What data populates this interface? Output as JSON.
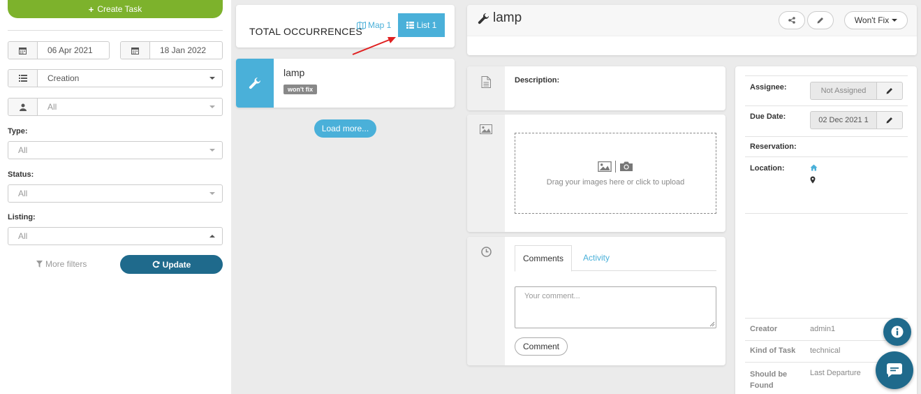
{
  "left_panel": {
    "create_task_label": "Create Task",
    "date_from": "06 Apr 2021",
    "date_to": "18 Jan 2022",
    "sort_value": "Creation",
    "user_placeholder": "All",
    "type_label": "Type:",
    "type_value": "All",
    "status_label": "Status:",
    "status_value": "All",
    "listing_label": "Listing:",
    "listing_value": "All",
    "more_filters_label": "More filters",
    "update_label": "Update"
  },
  "middle_panel": {
    "total_label": "TOTAL OCCURRENCES",
    "map_label": "Map 1",
    "list_label": "List 1",
    "task": {
      "title": "lamp",
      "badge": "won't fix"
    },
    "load_more_label": "Load more..."
  },
  "detail": {
    "title": "lamp",
    "status_dropdown": "Won't Fix",
    "description_label": "Description:",
    "upload_text": "Drag your images here or click to upload",
    "tabs": {
      "comments": "Comments",
      "activity": "Activity"
    },
    "comment_placeholder": "Your comment...",
    "comment_button": "Comment"
  },
  "info_panel": {
    "assignee_label": "Assignee:",
    "assignee_value": "Not Assigned",
    "due_date_label": "Due Date:",
    "due_date_value": "02 Dec 2021 1",
    "reservation_label": "Reservation:",
    "location_label": "Location:",
    "creator_label": "Creator",
    "creator_value": "admin1",
    "kind_label": "Kind of Task",
    "kind_value": "technical",
    "should_be_found_label_1": "Should be",
    "should_be_found_label_2": "Found",
    "should_be_found_value": "Last Departure"
  },
  "colors": {
    "green": "#7db22c",
    "blue_accent": "#4ab0d9",
    "dark_blue": "#1f6a8c",
    "annotation_arrow": "#e02020"
  }
}
